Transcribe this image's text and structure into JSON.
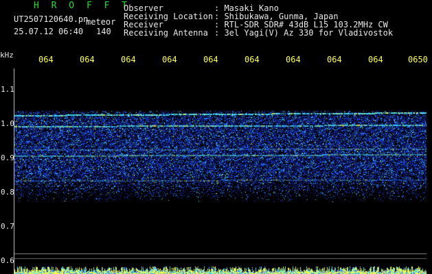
{
  "header": {
    "title": "H R O F F T",
    "filename": "UT2507120640.pn",
    "type_label": "meteor",
    "datetime": "25.07.12 06:40",
    "count": "140"
  },
  "info": [
    {
      "label": "Observer",
      "value": ": Masaki Kano"
    },
    {
      "label": "Receiving Location",
      "value": ": Shibukawa, Gunma, Japan"
    },
    {
      "label": "Receiver",
      "value": ": RTL-SDR SDR# 43dB L15 103.2MHz CW"
    },
    {
      "label": "Receiving Antenna",
      "value": ": 3el Yagi(V) Az 330 for Vladivostok"
    }
  ],
  "axis": {
    "unit": "kHz",
    "y_ticks": [
      "1.1",
      "1.0",
      "0.9",
      "0.8",
      "0.7",
      "0.6"
    ],
    "time_labels": [
      "064",
      "064",
      "064",
      "064",
      "064",
      "064",
      "064",
      "064",
      "064",
      "0650"
    ]
  },
  "colors": {
    "background": "#000000",
    "text": "#e8e8e8",
    "title": "#22dd33",
    "time_label": "#ffff55",
    "noise_dark": "#0a1a7a",
    "noise_blue": "#1f4cff",
    "noise_cyan": "#3fe0ff",
    "noise_yellow": "#ffff40"
  }
}
